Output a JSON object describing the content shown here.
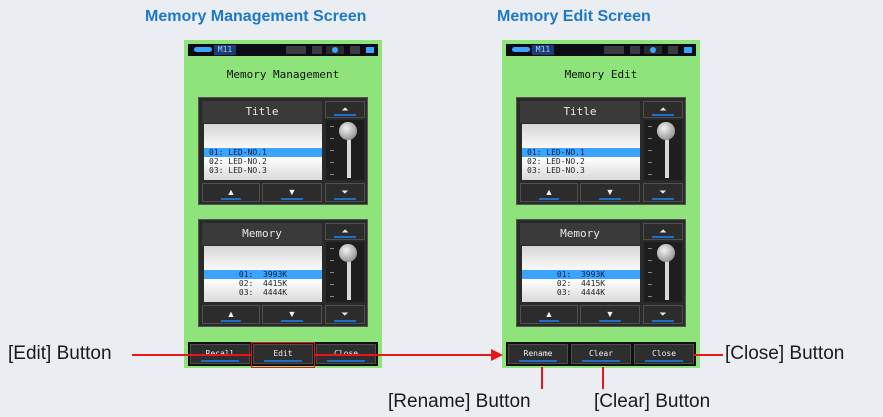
{
  "captions": {
    "left": "Memory Management Screen",
    "right": "Memory Edit Screen"
  },
  "status": {
    "memory_indicator": "M11"
  },
  "left_device": {
    "screen_title": "Memory Management",
    "title_panel": {
      "heading": "Title",
      "rows": [
        "01: LED-NO.1",
        "02: LED-NO.2",
        "03: LED-NO.3"
      ],
      "selected_index": 0
    },
    "memory_panel": {
      "heading": "Memory",
      "rows": [
        "01:  3993K",
        "02:  4415K",
        "03:  4444K"
      ],
      "selected_index": 0
    },
    "bottom_buttons": [
      "Recall",
      "Edit",
      "Close"
    ]
  },
  "right_device": {
    "screen_title": "Memory Edit",
    "title_panel": {
      "heading": "Title",
      "rows": [
        "01: LED-NO.1",
        "02: LED-NO.2",
        "03: LED-NO.3"
      ],
      "selected_index": 0
    },
    "memory_panel": {
      "heading": "Memory",
      "rows": [
        "01:  3993K",
        "02:  4415K",
        "03:  4444K"
      ],
      "selected_index": 0
    },
    "bottom_buttons": [
      "Rename",
      "Clear",
      "Close"
    ]
  },
  "icons": {
    "up": "▲",
    "down": "▼",
    "to_top": "⏶",
    "to_bottom": "⏷"
  },
  "callouts": {
    "edit": "[Edit] Button",
    "close": "[Close] Button",
    "rename": "[Rename] Button",
    "clear": "[Clear] Button"
  },
  "colors": {
    "caption": "#1e78c8",
    "device_bg": "#8ee47a",
    "selection": "#3aa4ff",
    "highlight": "#e8161a"
  }
}
